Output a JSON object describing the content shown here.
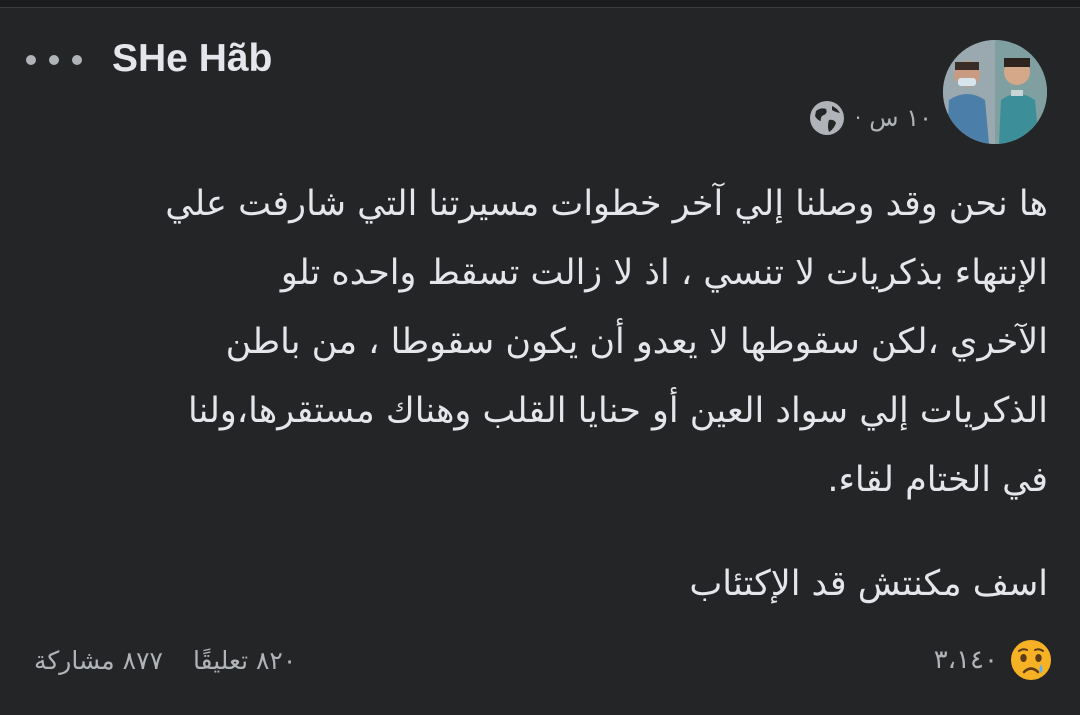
{
  "post": {
    "author": "SHe Hãb",
    "time": "١٠ س",
    "separator": "·",
    "privacy_icon": "globe-icon",
    "text_lines": [
      "ها نحن وقد وصلنا إلي آخر خطوات مسيرتنا التي شارفت علي",
      "الإنتهاء بذكريات لا تنسي ، اذ لا زالت تسقط واحده تلو",
      "الآخري ،لكن سقوطها لا يعدو أن يكون سقوطا ، من باطن",
      "الذكريات إلي سواد العين أو حنايا القلب وهناك مستقرها،ولنا",
      "في الختام لقاء."
    ],
    "text_extra": "اسف مكنتش قد الإكتئاب"
  },
  "footer": {
    "reaction_icon": "sad-face-icon",
    "reactions_count": "٣،١٤٠",
    "comments": "٨٢٠ تعليقًا",
    "shares": "٨٧٧ مشاركة"
  },
  "colors": {
    "background": "#242526",
    "text": "#e4e6eb",
    "secondary": "#b0b3b8",
    "reaction_face": "#f7b125"
  }
}
